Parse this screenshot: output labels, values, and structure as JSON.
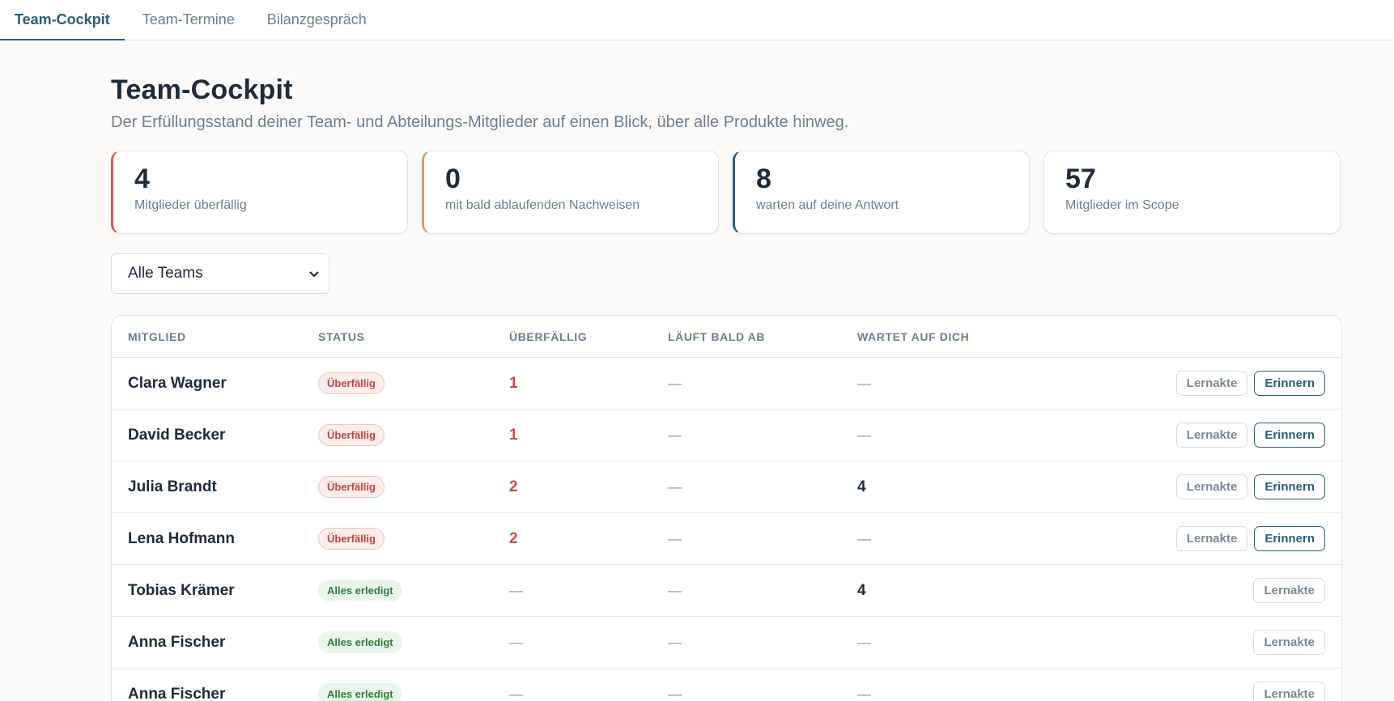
{
  "tabs": [
    {
      "label": "Team-Cockpit",
      "active": true
    },
    {
      "label": "Team-Termine",
      "active": false
    },
    {
      "label": "Bilanzgespräch",
      "active": false
    }
  ],
  "page": {
    "title": "Team-Cockpit",
    "subtitle": "Der Erfüllungsstand deiner Team- und Abteilungs-Mitglieder auf einen Blick, über alle Produkte hinweg."
  },
  "kpis": [
    {
      "value": "4",
      "label": "Mitglieder überfällig",
      "accent": "#cf5b55"
    },
    {
      "value": "0",
      "label": "mit bald ablaufenden Nachweisen",
      "accent": "#df9a6a"
    },
    {
      "value": "8",
      "label": "warten auf deine Antwort",
      "accent": "#2a5e7c"
    },
    {
      "value": "57",
      "label": "Mitglieder im Scope",
      "accent": null
    }
  ],
  "filter": {
    "selected": "Alle Teams"
  },
  "table": {
    "headers": [
      "MITGLIED",
      "STATUS",
      "ÜBERFÄLLIG",
      "LÄUFT BALD AB",
      "WARTET AUF DICH"
    ],
    "rows": [
      {
        "name": "Clara Wagner",
        "status": "Überfällig",
        "overdue": "1",
        "expiring": "—",
        "waiting": "—",
        "btn1": "Lernakte",
        "btn2": "Erinnern"
      },
      {
        "name": "David Becker",
        "status": "Überfällig",
        "overdue": "1",
        "expiring": "—",
        "waiting": "—",
        "btn1": "Lernakte",
        "btn2": "Erinnern"
      },
      {
        "name": "Julia Brandt",
        "status": "Überfällig",
        "overdue": "2",
        "expiring": "—",
        "waiting": "4",
        "btn1": "Lernakte",
        "btn2": "Erinnern"
      },
      {
        "name": "Lena Hofmann",
        "status": "Überfällig",
        "overdue": "2",
        "expiring": "—",
        "waiting": "—",
        "btn1": "Lernakte",
        "btn2": "Erinnern"
      },
      {
        "name": "Tobias Krämer",
        "status": "Alles erledigt",
        "overdue": "—",
        "expiring": "—",
        "waiting": "4",
        "btn1": "Lernakte"
      },
      {
        "name": "Anna Fischer",
        "status": "Alles erledigt",
        "overdue": "—",
        "expiring": "—",
        "waiting": "—",
        "btn1": "Lernakte"
      },
      {
        "name": "Anna Fischer",
        "status": "Alles erledigt",
        "overdue": "—",
        "expiring": "—",
        "waiting": "—",
        "btn1": "Lernakte"
      }
    ]
  },
  "colors": {
    "accent": "#2a5e7c",
    "overdue": "#c64d45",
    "done": "#2e7d3b"
  }
}
